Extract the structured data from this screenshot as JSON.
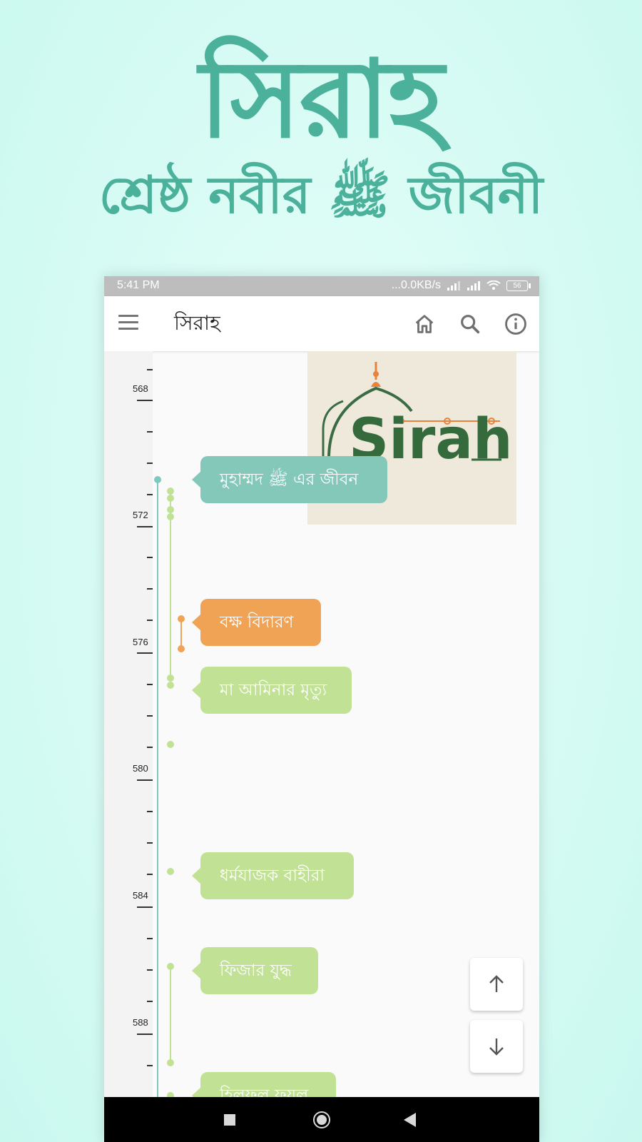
{
  "promo": {
    "title": "সিরাহ",
    "subtitle": "শ্রেষ্ঠ নবীর ﷺ জীবনী"
  },
  "status_bar": {
    "time": "5:41 PM",
    "network": "...0.0KB/s",
    "battery": "56"
  },
  "app_bar": {
    "title": "সিরাহ",
    "icons": [
      "menu-icon",
      "home-icon",
      "search-icon",
      "info-icon"
    ]
  },
  "timeline": {
    "year_labels": [
      "568",
      "572",
      "576",
      "580",
      "584",
      "588"
    ],
    "events": [
      {
        "label": "মুহাম্মদ ﷺ এর জীবন",
        "color": "#84c8ba"
      },
      {
        "label": "বক্ষ বিদারণ",
        "color": "#f0a255"
      },
      {
        "label": "মা আমিনার মৃত্যু",
        "color": "#c1e195"
      },
      {
        "label": "ধর্মযাজক বাহীরা",
        "color": "#c1e195"
      },
      {
        "label": "ফিজার যুদ্ধ",
        "color": "#c1e195"
      },
      {
        "label": "হিলফুল ফুযুল",
        "color": "#c1e195"
      }
    ],
    "logo_text": "Sirah"
  },
  "fabs": [
    "arrow-up-icon",
    "arrow-down-icon"
  ],
  "nav_bar": [
    "recents-button",
    "home-button",
    "back-button"
  ],
  "colors": {
    "accent": "#4bb19b",
    "main_line": "#7ec9bd",
    "green_event": "#c1e195",
    "orange_event": "#f0a255",
    "teal_event": "#84c8ba"
  }
}
